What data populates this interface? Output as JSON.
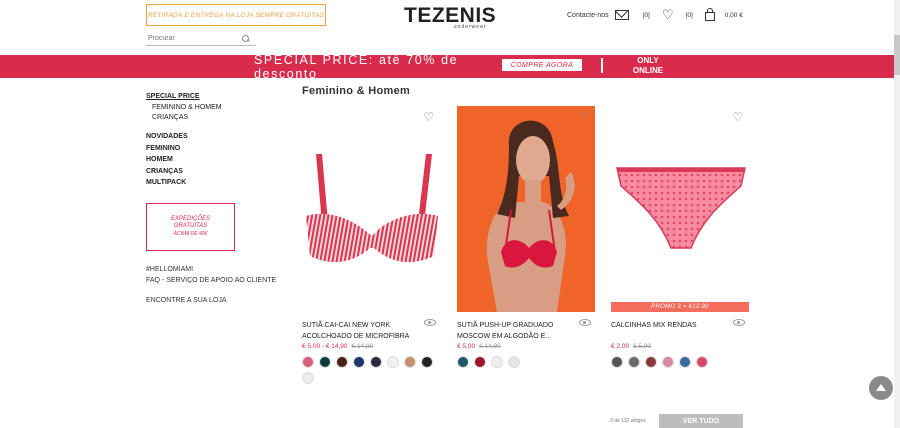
{
  "header": {
    "promo": "RETIRADA E ENTREGA NA LOJA SEMPRE GRATUITAS",
    "search_placeholder": "Procurar",
    "brand": "TEZENIS",
    "brand_sub": "underwear",
    "contact": "Contacte-nos",
    "wishlist_count": "[0]",
    "cart_count": "[0]",
    "cart_total": "0,00 €"
  },
  "banner": {
    "text": "SPECIAL PRICE: até 70% de desconto",
    "button": "COMPRE AGORA",
    "online_line1": "ONLY",
    "online_line2": "ONLINE",
    "color": "#d92b4b"
  },
  "sidebar": {
    "special": "SPECIAL PRICE",
    "sub_items": [
      "FEMININO & HOMEM",
      "CRIANÇAS"
    ],
    "categories": [
      "NOVIDADES",
      "FEMININO",
      "HOMEM",
      "CRIANÇAS",
      "MULTIPACK"
    ],
    "shipping_line1": "EXPEDIÇÕES",
    "shipping_line2": "GRATUITAS",
    "shipping_line3": "ACIMA DE 40€",
    "links": [
      "#HELLOMIAMI",
      "FAQ - SERVIÇO DE APOIO AO CLIENTE",
      "ENCONTRE A SUA LOJA"
    ]
  },
  "main": {
    "title": "Feminino & Homem",
    "products": [
      {
        "name_line1": "SUTIÃ CAI-CAI NEW YORK",
        "name_line2": "ACOLCHOADO DE MICROFIBRA",
        "price": "€ 5,00 - € 14,90",
        "old_price": "€ 14,90",
        "swatches": [
          "#d8607a",
          "#0e3b3c",
          "#4a1f18",
          "#1f3570",
          "#2b2b3d",
          "#f2eef2",
          "#c09070",
          "#222222",
          "#ececec"
        ]
      },
      {
        "name_line1": "SUTIÃ PUSH-UP GRADUADO",
        "name_line2": "MOSCOW EM ALGODÃO E...",
        "price": "€ 5,00",
        "old_price": "€ 14,90",
        "swatches": [
          "#1a5a6a",
          "#a0142c",
          "#eeeeee",
          "#e6e6e6"
        ]
      },
      {
        "name_line1": "CALCINHAS MIX RENDAS",
        "name_line2": "",
        "price": "€ 2,00",
        "old_price": "€ 5,90",
        "promo": "PROMO 3 = €12.90",
        "swatches": [
          "#555555",
          "#6a6a6a",
          "#8a3a3a",
          "#d88aa0",
          "#3a6a9a",
          "#d84a6a"
        ]
      }
    ],
    "pagination": "3 de 132 artigos",
    "see_all": "VER TUDO"
  }
}
